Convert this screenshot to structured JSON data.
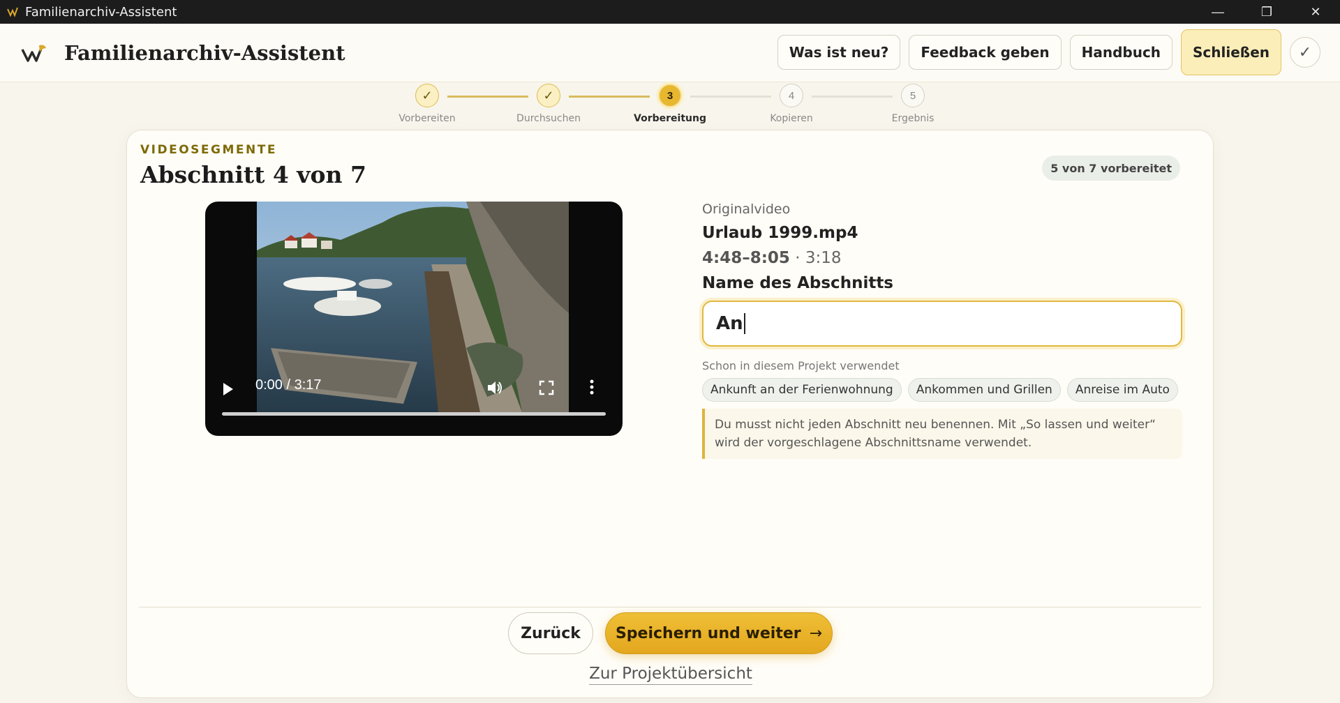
{
  "window": {
    "title": "Familienarchiv-Assistent",
    "controls": {
      "minimize": "—",
      "restore": "❐",
      "close": "✕"
    }
  },
  "header": {
    "app_name": "Familienarchiv-Assistent",
    "buttons": {
      "whats_new": "Was ist neu?",
      "feedback": "Feedback geben",
      "manual": "Handbuch",
      "close": "Schließen",
      "check": "✓"
    }
  },
  "stepper": {
    "steps": [
      {
        "number": "✓",
        "label": "Vorbereiten",
        "state": "done"
      },
      {
        "number": "✓",
        "label": "Durchsuchen",
        "state": "done"
      },
      {
        "number": "3",
        "label": "Vorbereitung",
        "state": "active"
      },
      {
        "number": "4",
        "label": "Kopieren",
        "state": "todo"
      },
      {
        "number": "5",
        "label": "Ergebnis",
        "state": "todo"
      }
    ]
  },
  "card": {
    "eyebrow": "VIDEOSEGMENTE",
    "title": "Abschnitt 4 von 7",
    "badge": "5 von 7 vorbereitet"
  },
  "video": {
    "time": "0:00 / 3:17",
    "progress": 0
  },
  "info": {
    "original_label": "Originalvideo",
    "filename": "Urlaub 1999.mp4",
    "range": "4:48–8:05",
    "duration": " · 3:18",
    "name_label": "Name des Abschnitts",
    "name_value": "An",
    "used_label": "Schon in diesem Projekt verwendet",
    "chips": [
      "Ankunft an der Ferienwohnung",
      "Ankommen und Grillen",
      "Anreise im Auto"
    ],
    "hint": "Du musst nicht jeden Abschnitt neu benennen. Mit „So lassen und weiter“ wird der vorgeschlagene Abschnittsname verwendet."
  },
  "actions": {
    "back": "Zurück",
    "next": "Speichern und weiter",
    "next_arrow": "→",
    "overview": "Zur Projektübersicht"
  },
  "colors": {
    "accent": "#e8b730",
    "eyebrow": "#7d6a08",
    "titlebar": "#1c1c1c"
  }
}
